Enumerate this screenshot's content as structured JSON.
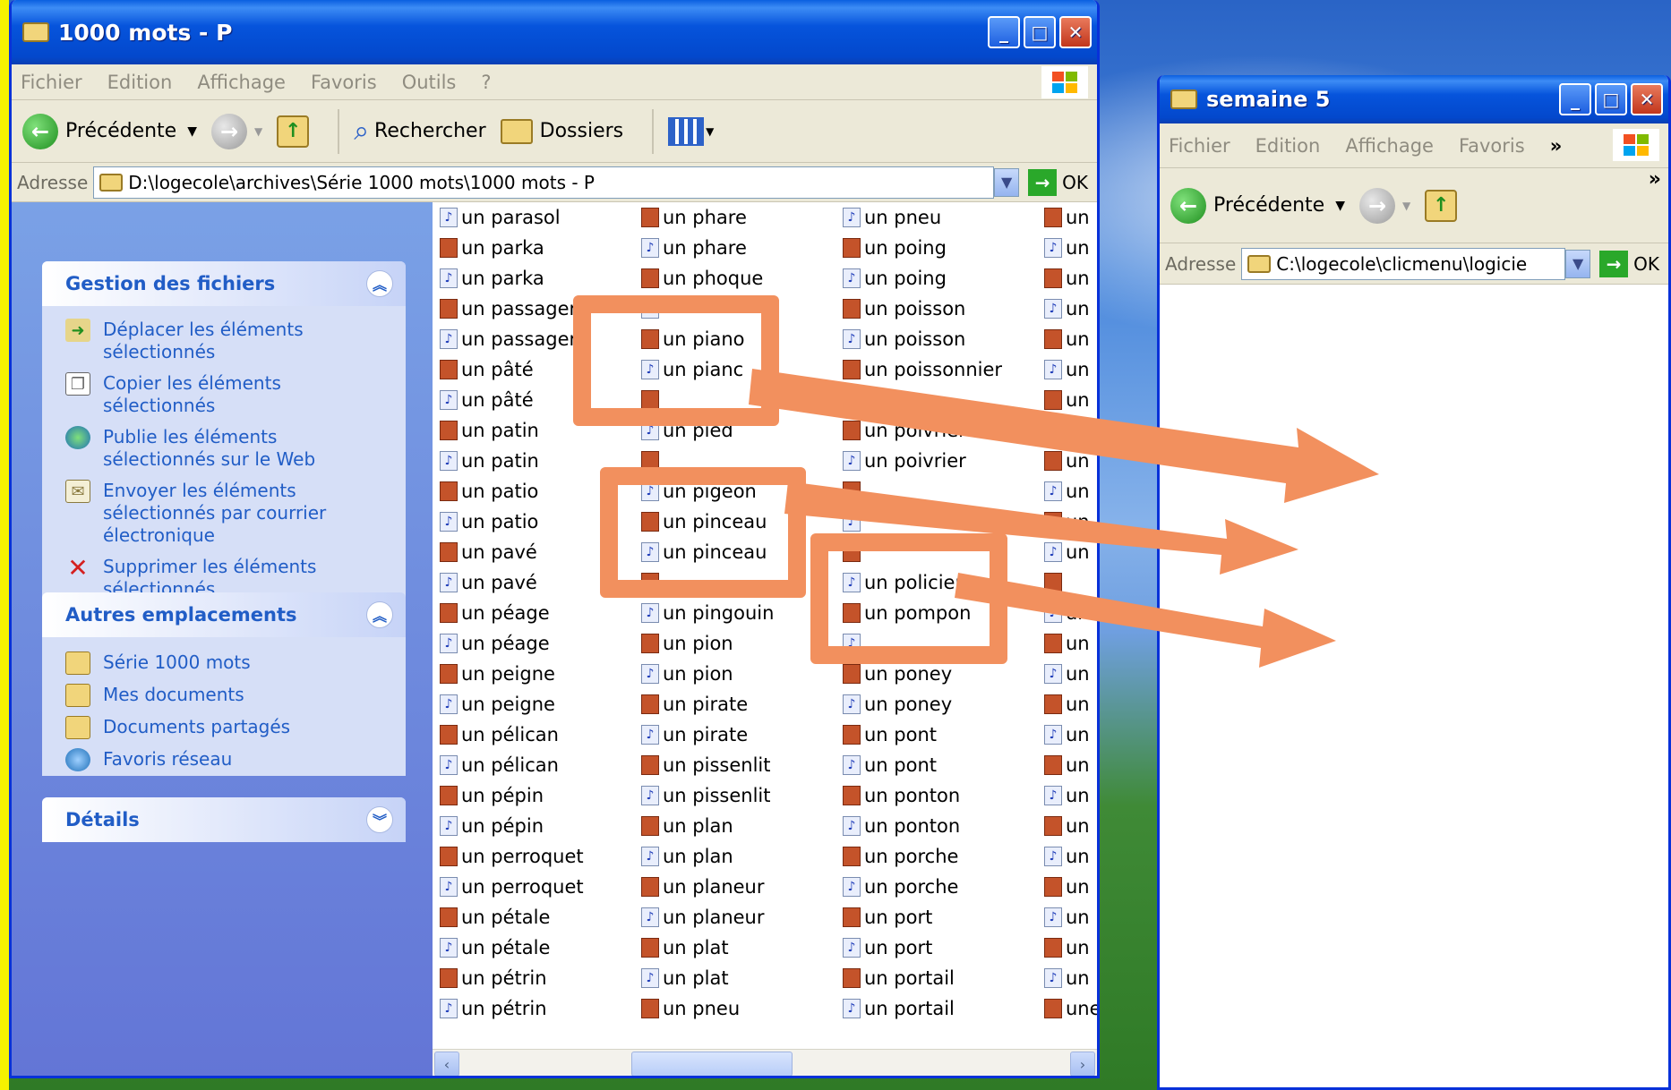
{
  "win1": {
    "title": "1000 mots - P",
    "menu": [
      "Fichier",
      "Edition",
      "Affichage",
      "Favoris",
      "Outils",
      "?"
    ],
    "toolbar": {
      "back": "Précédente",
      "search": "Rechercher",
      "folders": "Dossiers"
    },
    "address": {
      "label": "Adresse",
      "path": "D:\\logecole\\archives\\Série 1000 mots\\1000 mots - P",
      "go": "OK"
    },
    "file_tasks": {
      "title": "Gestion des fichiers",
      "items": [
        {
          "icon": "move-icon",
          "label": "Déplacer les éléments sélectionnés"
        },
        {
          "icon": "copy-icon",
          "label": "Copier les éléments sélectionnés"
        },
        {
          "icon": "publish-web-icon",
          "label": "Publie les éléments sélectionnés sur le Web"
        },
        {
          "icon": "email-icon",
          "label": "Envoyer les éléments sélectionnés par courrier électronique"
        },
        {
          "icon": "delete-icon",
          "label": "Supprimer les éléments sélectionnés"
        }
      ]
    },
    "other_places": {
      "title": "Autres emplacements",
      "items": [
        {
          "icon": "folder-icon",
          "label": "Série 1000 mots"
        },
        {
          "icon": "my-documents-icon",
          "label": "Mes documents"
        },
        {
          "icon": "folder-icon",
          "label": "Documents partagés"
        },
        {
          "icon": "network-icon",
          "label": "Favoris réseau"
        }
      ]
    },
    "details": {
      "title": "Détails"
    },
    "files": [
      [
        {
          "t": "s",
          "n": "un parasol"
        },
        {
          "t": "i",
          "n": "un parka"
        },
        {
          "t": "s",
          "n": "un parka"
        },
        {
          "t": "i",
          "n": "un passager"
        },
        {
          "t": "s",
          "n": "un passager"
        },
        {
          "t": "i",
          "n": "un pâté"
        },
        {
          "t": "s",
          "n": "un pâté"
        },
        {
          "t": "i",
          "n": "un patin"
        },
        {
          "t": "s",
          "n": "un patin"
        },
        {
          "t": "i",
          "n": "un patio"
        },
        {
          "t": "s",
          "n": "un patio"
        },
        {
          "t": "i",
          "n": "un pavé"
        },
        {
          "t": "s",
          "n": "un pavé"
        },
        {
          "t": "i",
          "n": "un péage"
        },
        {
          "t": "s",
          "n": "un péage"
        },
        {
          "t": "i",
          "n": "un peigne"
        },
        {
          "t": "s",
          "n": "un peigne"
        },
        {
          "t": "i",
          "n": "un pélican"
        },
        {
          "t": "s",
          "n": "un pélican"
        },
        {
          "t": "i",
          "n": "un pépin"
        },
        {
          "t": "s",
          "n": "un pépin"
        },
        {
          "t": "i",
          "n": "un perroquet"
        },
        {
          "t": "s",
          "n": "un perroquet"
        },
        {
          "t": "i",
          "n": "un pétale"
        },
        {
          "t": "s",
          "n": "un pétale"
        },
        {
          "t": "i",
          "n": "un pétrin"
        },
        {
          "t": "s",
          "n": "un pétrin"
        }
      ],
      [
        {
          "t": "i",
          "n": "un phare"
        },
        {
          "t": "s",
          "n": "un phare"
        },
        {
          "t": "i",
          "n": "un phoque"
        },
        {
          "t": "s",
          "n": ""
        },
        {
          "t": "i",
          "n": "un piano"
        },
        {
          "t": "s",
          "n": "un pianc"
        },
        {
          "t": "i",
          "n": ""
        },
        {
          "t": "s",
          "n": "un pied"
        },
        {
          "t": "i",
          "n": ""
        },
        {
          "t": "s",
          "n": "un pigeon"
        },
        {
          "t": "i",
          "n": "un pinceau"
        },
        {
          "t": "s",
          "n": "un pinceau"
        },
        {
          "t": "i",
          "n": ""
        },
        {
          "t": "s",
          "n": "un pingouin"
        },
        {
          "t": "i",
          "n": "un pion"
        },
        {
          "t": "s",
          "n": "un pion"
        },
        {
          "t": "i",
          "n": "un pirate"
        },
        {
          "t": "s",
          "n": "un pirate"
        },
        {
          "t": "i",
          "n": "un pissenlit"
        },
        {
          "t": "s",
          "n": "un pissenlit"
        },
        {
          "t": "i",
          "n": "un plan"
        },
        {
          "t": "s",
          "n": "un plan"
        },
        {
          "t": "i",
          "n": "un planeur"
        },
        {
          "t": "s",
          "n": "un planeur"
        },
        {
          "t": "i",
          "n": "un plat"
        },
        {
          "t": "s",
          "n": "un plat"
        },
        {
          "t": "i",
          "n": "un pneu"
        }
      ],
      [
        {
          "t": "s",
          "n": "un pneu"
        },
        {
          "t": "i",
          "n": "un poing"
        },
        {
          "t": "s",
          "n": "un poing"
        },
        {
          "t": "i",
          "n": "un poisson"
        },
        {
          "t": "s",
          "n": "un poisson"
        },
        {
          "t": "i",
          "n": "un poissonnier"
        },
        {
          "t": "s",
          "n": ""
        },
        {
          "t": "i",
          "n": "un poivrier"
        },
        {
          "t": "s",
          "n": "un poivrier"
        },
        {
          "t": "i",
          "n": ""
        },
        {
          "t": "s",
          "n": ""
        },
        {
          "t": "i",
          "n": ""
        },
        {
          "t": "s",
          "n": "un policier"
        },
        {
          "t": "i",
          "n": "un pompon"
        },
        {
          "t": "s",
          "n": ""
        },
        {
          "t": "i",
          "n": "un poney"
        },
        {
          "t": "s",
          "n": "un poney"
        },
        {
          "t": "i",
          "n": "un pont"
        },
        {
          "t": "s",
          "n": "un pont"
        },
        {
          "t": "i",
          "n": "un ponton"
        },
        {
          "t": "s",
          "n": "un ponton"
        },
        {
          "t": "i",
          "n": "un porche"
        },
        {
          "t": "s",
          "n": "un porche"
        },
        {
          "t": "i",
          "n": "un port"
        },
        {
          "t": "s",
          "n": "un port"
        },
        {
          "t": "i",
          "n": "un portail"
        },
        {
          "t": "s",
          "n": "un portail"
        }
      ],
      [
        {
          "t": "i",
          "n": "un"
        },
        {
          "t": "s",
          "n": "un"
        },
        {
          "t": "i",
          "n": "un"
        },
        {
          "t": "s",
          "n": "un"
        },
        {
          "t": "i",
          "n": "un"
        },
        {
          "t": "s",
          "n": "un"
        },
        {
          "t": "i",
          "n": "un"
        },
        {
          "t": "s",
          "n": "un"
        },
        {
          "t": "i",
          "n": "un"
        },
        {
          "t": "s",
          "n": "un"
        },
        {
          "t": "i",
          "n": "un"
        },
        {
          "t": "s",
          "n": "un"
        },
        {
          "t": "i",
          "n": ""
        },
        {
          "t": "s",
          "n": "un"
        },
        {
          "t": "i",
          "n": "un"
        },
        {
          "t": "s",
          "n": "un"
        },
        {
          "t": "i",
          "n": "un"
        },
        {
          "t": "s",
          "n": "un"
        },
        {
          "t": "i",
          "n": "un"
        },
        {
          "t": "s",
          "n": "un"
        },
        {
          "t": "i",
          "n": "un"
        },
        {
          "t": "s",
          "n": "un"
        },
        {
          "t": "i",
          "n": "un"
        },
        {
          "t": "s",
          "n": "un"
        },
        {
          "t": "i",
          "n": "un"
        },
        {
          "t": "s",
          "n": "un"
        },
        {
          "t": "i",
          "n": "une"
        }
      ]
    ]
  },
  "win2": {
    "title": "semaine 5",
    "menu": [
      "Fichier",
      "Edition",
      "Affichage",
      "Favoris"
    ],
    "more": "»",
    "toolbar": {
      "back": "Précédente"
    },
    "address": {
      "label": "Adresse",
      "path": "C:\\logecole\\clicmenu\\logicie",
      "go": "OK"
    }
  },
  "colors": {
    "highlight": "#f2905e",
    "title_blue": "#0654dc",
    "taskpane_link": "#215dc6"
  }
}
